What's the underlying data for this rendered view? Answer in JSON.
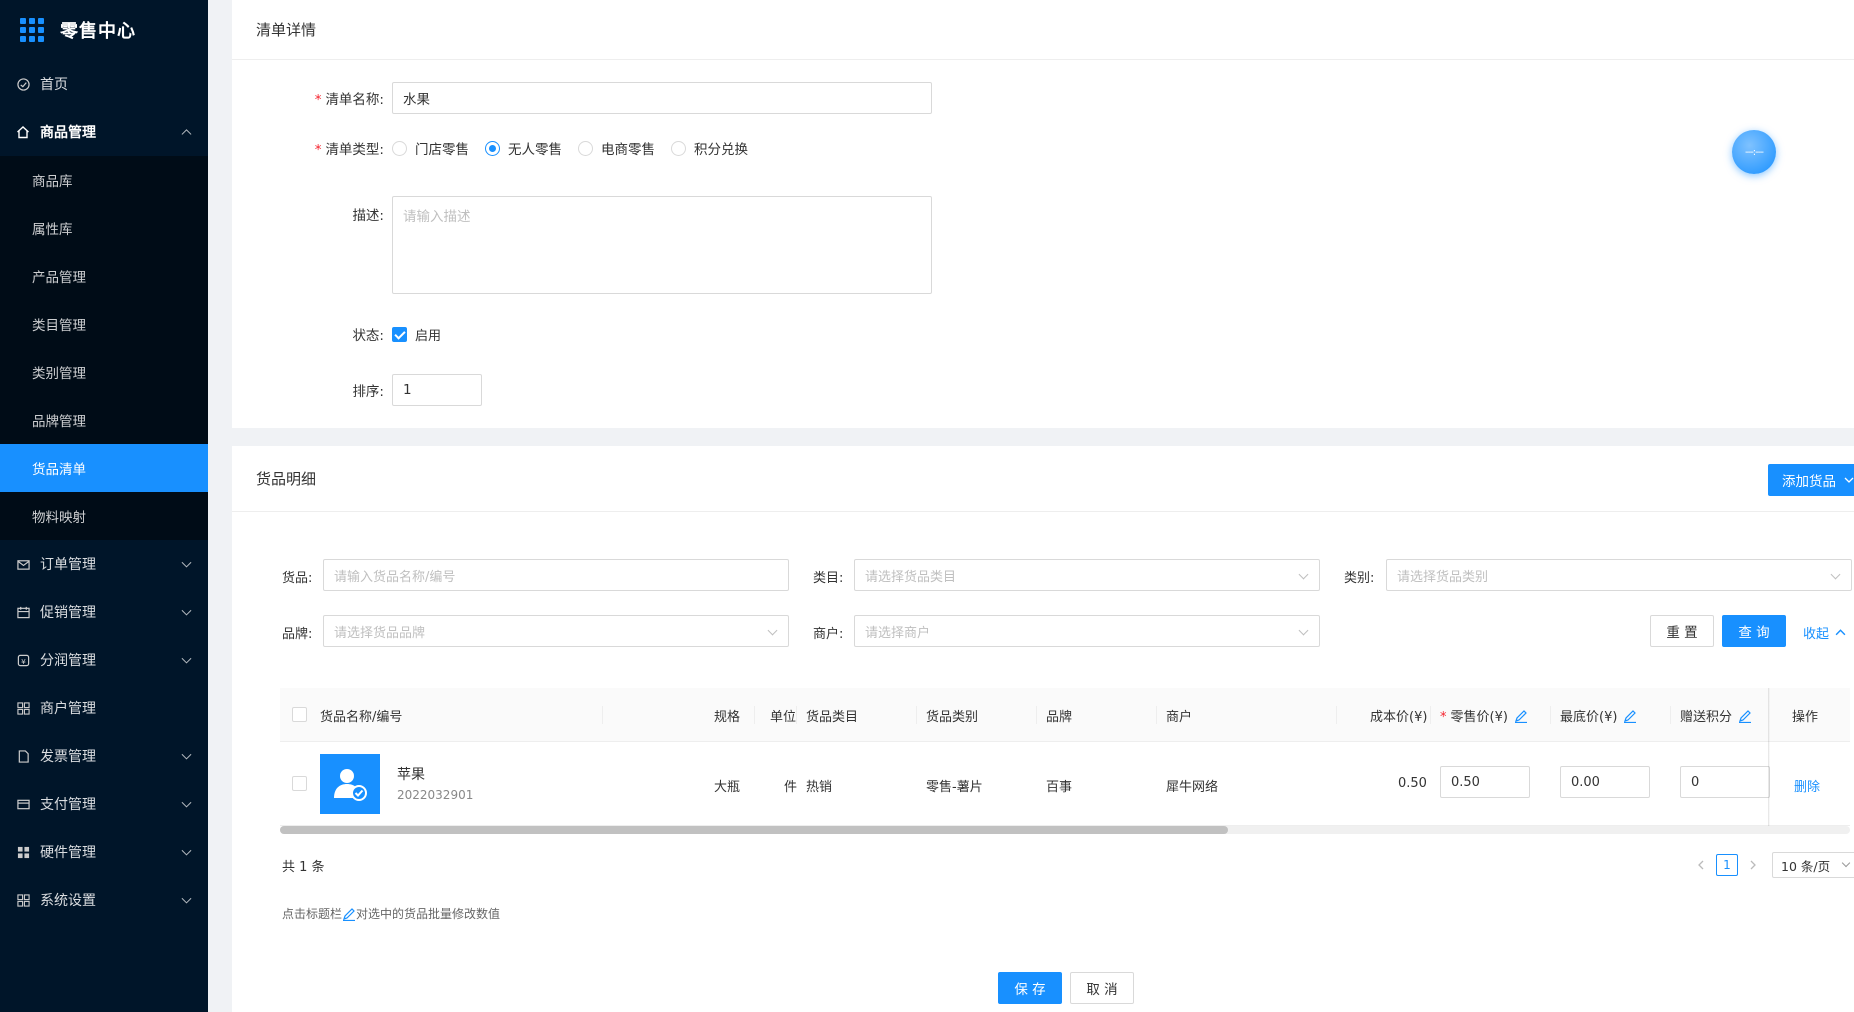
{
  "app": {
    "title": "零售中心"
  },
  "sidebar": {
    "items": [
      {
        "label": "首页",
        "icon": "dashboard-icon"
      },
      {
        "label": "商品管理",
        "icon": "home-icon",
        "open": true,
        "children": [
          "商品库",
          "属性库",
          "产品管理",
          "类目管理",
          "类别管理",
          "品牌管理",
          "货品清单",
          "物料映射"
        ],
        "active_child": "货品清单"
      },
      {
        "label": "订单管理",
        "icon": "mail-icon"
      },
      {
        "label": "促销管理",
        "icon": "calendar-icon"
      },
      {
        "label": "分润管理",
        "icon": "share-icon"
      },
      {
        "label": "商户管理",
        "icon": "appstore-icon"
      },
      {
        "label": "发票管理",
        "icon": "file-icon"
      },
      {
        "label": "支付管理",
        "icon": "wallet-icon"
      },
      {
        "label": "硬件管理",
        "icon": "grid-icon"
      },
      {
        "label": "系统设置",
        "icon": "setting-icon"
      }
    ]
  },
  "detail": {
    "title": "清单详情",
    "name_label": "清单名称:",
    "name_value": "水果",
    "type_label": "清单类型:",
    "type_options": [
      "门店零售",
      "无人零售",
      "电商零售",
      "积分兑换"
    ],
    "type_selected": "无人零售",
    "desc_label": "描述:",
    "desc_placeholder": "请输入描述",
    "status_label": "状态:",
    "status_value": "启用",
    "sort_label": "排序:",
    "sort_value": "1",
    "float_button_text": "---:---"
  },
  "goods": {
    "title": "货品明细",
    "add_button": "添加货品",
    "filters": {
      "goods_label": "货品:",
      "goods_placeholder": "请输入货品名称/编号",
      "category_label": "类目:",
      "category_placeholder": "请选择货品类目",
      "type_label": "类别:",
      "type_placeholder": "请选择货品类别",
      "brand_label": "品牌:",
      "brand_placeholder": "请选择货品品牌",
      "merchant_label": "商户:",
      "merchant_placeholder": "请选择商户",
      "reset_button": "重 置",
      "query_button": "查 询",
      "collapse_link": "收起"
    },
    "columns": [
      "货品名称/编号",
      "规格",
      "单位",
      "货品类目",
      "货品类别",
      "品牌",
      "商户",
      "成本价(¥)",
      "零售价(¥)",
      "最底价(¥)",
      "赠送积分",
      "操作"
    ],
    "rows": [
      {
        "name": "苹果",
        "code": "2022032901",
        "spec": "大瓶",
        "unit": "件",
        "category": "热销",
        "type": "零售-薯片",
        "brand": "百事",
        "merchant": "犀牛网络",
        "cost": "0.50",
        "retail": "0.50",
        "min": "0.00",
        "points": "0",
        "action": "删除"
      }
    ],
    "total": "共 1 条",
    "current_page": "1",
    "page_size": "10 条/页",
    "hint_prefix": "点击标题栏",
    "hint_suffix": "对选中的货品批量修改数值",
    "save_button": "保 存",
    "cancel_button": "取 消"
  },
  "colors": {
    "primary": "#1890ff",
    "sidebar_bg": "#001529",
    "danger": "#f5222d"
  }
}
